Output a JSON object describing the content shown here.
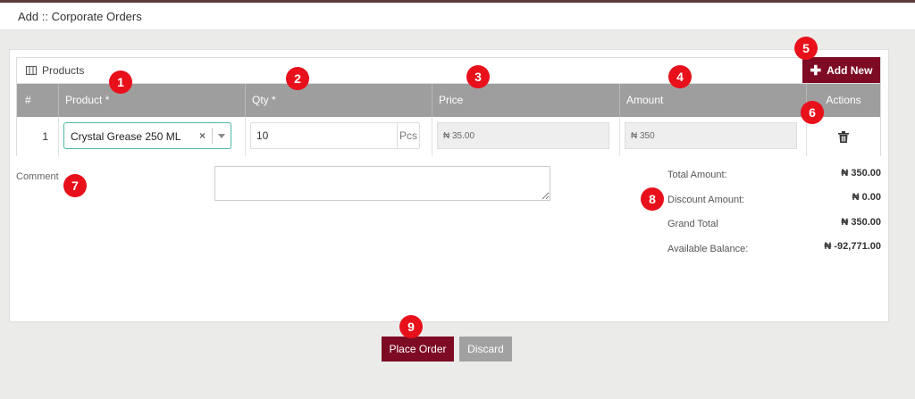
{
  "page": {
    "title": "Add :: Corporate Orders"
  },
  "products": {
    "section_label": "Products",
    "add_new_label": "Add New",
    "columns": {
      "index": "#",
      "product": "Product *",
      "qty": "Qty *",
      "price": "Price",
      "amount": "Amount",
      "actions": "Actions"
    },
    "rows": [
      {
        "index": "1",
        "product": "Crystal Grease 250 ML",
        "qty": "10",
        "unit": "Pcs",
        "price": "₦ 35.00",
        "amount": "₦ 350"
      }
    ]
  },
  "comment": {
    "label": "Comment",
    "value": ""
  },
  "totals": {
    "total_amount_label": "Total Amount:",
    "total_amount": "₦ 350.00",
    "discount_amount_label": "Discount Amount:",
    "discount_amount": "₦ 0.00",
    "grand_total_label": "Grand Total",
    "grand_total": "₦ 350.00",
    "available_balance_label": "Available Balance:",
    "available_balance": "₦ -92,771.00"
  },
  "actions": {
    "place_order_label": "Place Order",
    "discard_label": "Discard"
  },
  "markers": [
    "1",
    "2",
    "3",
    "4",
    "5",
    "6",
    "7",
    "8",
    "9"
  ],
  "colors": {
    "primary": "#7d0b24",
    "secondary_button": "#a1a1a1",
    "table_header": "#9e9e9e",
    "marker": "#e8101b",
    "select_border": "#4cb9a5"
  },
  "icons": {
    "products": "columns-icon",
    "add": "plus-icon",
    "delete": "trash-icon",
    "clear": "clear-icon",
    "dropdown": "caret-down-icon"
  }
}
